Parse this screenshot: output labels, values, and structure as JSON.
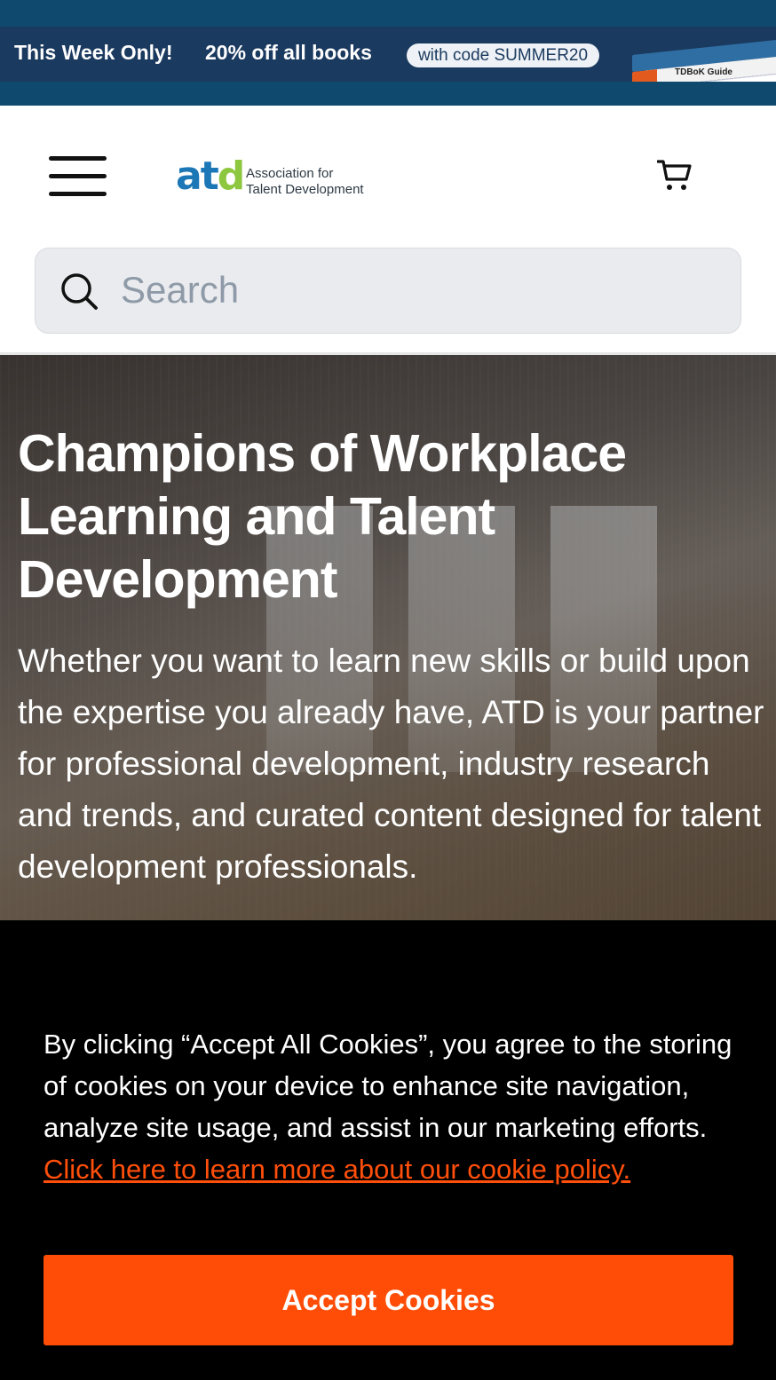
{
  "promo": {
    "headline": "This Week Only!",
    "offer": "20% off all books",
    "code_text": "with code SUMMER20",
    "book_title": "TDBoK Guide"
  },
  "header": {
    "logo_mark": "atd",
    "logo_line1": "Association for",
    "logo_line2": "Talent Development",
    "menu_icon": "hamburger-menu-icon",
    "cart_icon": "shopping-cart-icon"
  },
  "search": {
    "placeholder": "Search",
    "icon": "search-icon"
  },
  "hero": {
    "title": "Champions of Workplace Learning and Talent Development",
    "body": "Whether you want to learn new skills or build upon the expertise you already have, ATD is your partner for professional development, industry research and trends, and curated content designed for talent development professionals."
  },
  "cookie": {
    "text": "By clicking “Accept All Cookies”, you agree to the storing of cookies on your device to enhance site navigation, analyze site usage, and assist in our marketing efforts.",
    "link": "Click here to learn more about our cookie policy.",
    "button": "Accept Cookies"
  },
  "colors": {
    "promo_bg": "#1b3a5f",
    "accent_orange": "#ff4d07",
    "logo_blue": "#1c77b6",
    "logo_green": "#8dc63f"
  }
}
